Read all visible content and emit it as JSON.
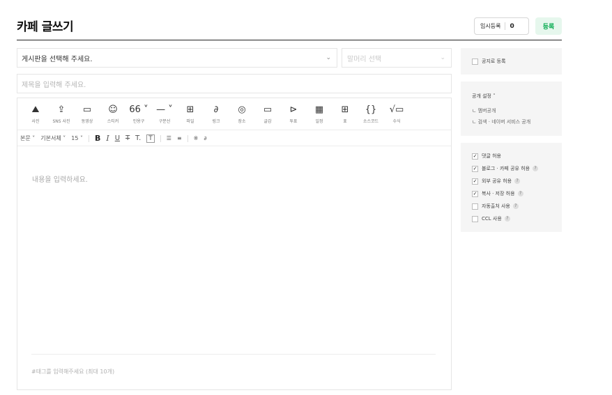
{
  "header": {
    "title": "카페 글쓰기",
    "temp_save_label": "임시등록",
    "temp_save_count": "0",
    "register_label": "등록"
  },
  "board_select": {
    "placeholder": "게시판을 선택해 주세요.",
    "chevron": "⌄"
  },
  "header_select": {
    "placeholder": "말머리 선택",
    "chevron": "⌄"
  },
  "title_input": {
    "placeholder": "제목을 입력해 주세요."
  },
  "toolbar_insert": [
    {
      "label": "사진",
      "icon": "photo-icon",
      "glyph": "⛰"
    },
    {
      "label": "SNS 사진",
      "icon": "sns-photo-icon",
      "glyph": "⇪"
    },
    {
      "label": "동영상",
      "icon": "video-icon",
      "glyph": "▭"
    },
    {
      "label": "스티커",
      "icon": "sticker-icon",
      "glyph": "☺"
    },
    {
      "label": "인용구",
      "icon": "quote-icon",
      "glyph": "66 ˅"
    },
    {
      "label": "구분선",
      "icon": "divider-icon",
      "glyph": "— ˅"
    },
    {
      "label": "파일",
      "icon": "file-icon",
      "glyph": "⊞"
    },
    {
      "label": "링크",
      "icon": "link-icon",
      "glyph": "∂"
    },
    {
      "label": "장소",
      "icon": "place-icon",
      "glyph": "◎"
    },
    {
      "label": "글감",
      "icon": "material-icon",
      "glyph": "▭"
    },
    {
      "label": "투표",
      "icon": "vote-icon",
      "glyph": "⊳"
    },
    {
      "label": "일정",
      "icon": "schedule-icon",
      "glyph": "▦"
    },
    {
      "label": "표",
      "icon": "table-icon",
      "glyph": "⊞"
    },
    {
      "label": "소스코드",
      "icon": "source-code-icon",
      "glyph": "{}"
    },
    {
      "label": "수식",
      "icon": "formula-icon",
      "glyph": "√▭"
    }
  ],
  "toolbar_format": {
    "paragraph": "본문 ˅",
    "font": "기본서체 ˅",
    "size": "15 ˅",
    "bold": "B",
    "italic": "I",
    "underline": "U",
    "strike": "T",
    "text_color": "T.",
    "bg_color": "T",
    "align": "☰",
    "line_height": "≡",
    "special": "※",
    "link": "∂"
  },
  "editor": {
    "content_placeholder": "내용을 입력하세요.",
    "tag_placeholder": "#태그를 입력해주세요 (최대 10개)"
  },
  "sidebar": {
    "notice_label": "공지로 등록",
    "public_title": "공개 설정 ˅",
    "public_items": [
      "ㄴ 멤버공개",
      "ㄴ 검색 · 네이버 서비스 공개"
    ],
    "options": [
      {
        "label": "댓글 허용",
        "checked": true,
        "help": false
      },
      {
        "label": "블로그 · 카페 공유 허용",
        "checked": true,
        "help": true
      },
      {
        "label": "외부 공유 허용",
        "checked": true,
        "help": true
      },
      {
        "label": "복사 · 저장 허용",
        "checked": true,
        "help": true
      },
      {
        "label": "자동출처 사용",
        "checked": false,
        "help": true
      },
      {
        "label": "CCL 사용",
        "checked": false,
        "help": true
      }
    ],
    "help_glyph": "?",
    "check_glyph": "✓"
  },
  "colors": {
    "accent_green": "#03a94d",
    "accent_green_bg": "#e6f7ed",
    "panel_bg": "#f5f5f5"
  }
}
